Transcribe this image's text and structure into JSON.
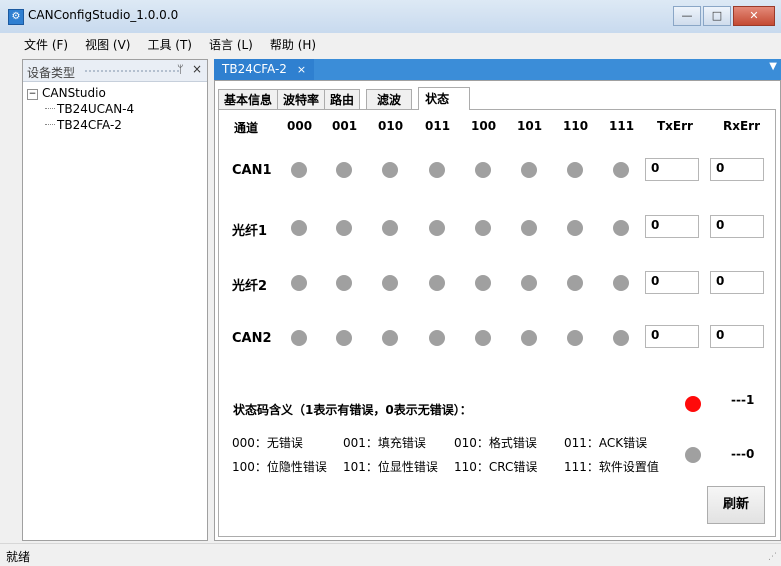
{
  "window": {
    "title": "CANConfigStudio_1.0.0.0",
    "min_label": "—",
    "max_label": "□",
    "close_label": "✕"
  },
  "menu": [
    "文件 (F)",
    "视图 (V)",
    "工具 (T)",
    "语言 (L)",
    "帮助 (H)"
  ],
  "left_panel": {
    "title": "设备类型",
    "pin": "ᛘ",
    "close": "×",
    "root": "CANStudio",
    "children": [
      "TB24UCAN-4",
      "TB24CFA-2"
    ]
  },
  "doc_tab": {
    "label": "TB24CFA-2",
    "close": "×"
  },
  "tabs": [
    "基本信息",
    "波特率",
    "路由",
    "滤波",
    "状态"
  ],
  "active_tab": 4,
  "grid": {
    "headers": [
      "通道",
      "000",
      "001",
      "010",
      "011",
      "100",
      "101",
      "110",
      "111",
      "TxErr",
      "RxErr"
    ],
    "rows": [
      {
        "label": "CAN1",
        "leds": [
          0,
          0,
          0,
          0,
          0,
          0,
          0,
          0
        ],
        "txerr": "0",
        "rxerr": "0"
      },
      {
        "label": "光纤1",
        "leds": [
          0,
          0,
          0,
          0,
          0,
          0,
          0,
          0
        ],
        "txerr": "0",
        "rxerr": "0"
      },
      {
        "label": "光纤2",
        "leds": [
          0,
          0,
          0,
          0,
          0,
          0,
          0,
          0
        ],
        "txerr": "0",
        "rxerr": "0"
      },
      {
        "label": "CAN2",
        "leds": [
          0,
          0,
          0,
          0,
          0,
          0,
          0,
          0
        ],
        "txerr": "0",
        "rxerr": "0"
      }
    ]
  },
  "legend": {
    "title": "状态码含义（1表示有错误，0表示无错误）：",
    "codes": [
      "000：无错误",
      "001：填充错误",
      "010：格式错误",
      "011：ACK错误",
      "100：位隐性错误",
      "101：位显性错误",
      "110：CRC错误",
      "111：软件设置值"
    ],
    "on_label": "---1",
    "off_label": "---0"
  },
  "colors": {
    "led_on": "#ff0a0a",
    "led_off": "#a0a0a0",
    "doc_tab": "#3b8dd8"
  },
  "refresh_label": "刷新",
  "status": "就绪"
}
